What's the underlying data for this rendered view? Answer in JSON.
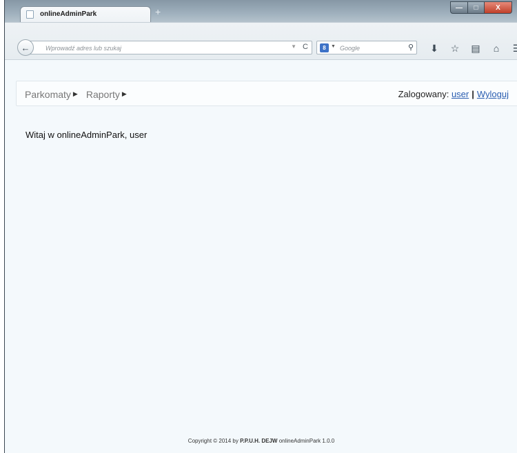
{
  "browser": {
    "tab_title": "onlineAdminPark",
    "new_tab_label": "+",
    "url_placeholder": "Wprowadź adres lub szukaj",
    "search_engine_label": "8",
    "search_placeholder": "Google",
    "icons": [
      "back-icon",
      "reload-icon",
      "search-icon",
      "download-icon",
      "bookmark-star-icon",
      "bookmarks-list-icon",
      "home-icon",
      "menu-icon"
    ]
  },
  "window_controls": {
    "minimize": "—",
    "maximize": "□",
    "close": "X"
  },
  "nav": {
    "menu": [
      {
        "label": "Parkomaty"
      },
      {
        "label": "Raporty"
      }
    ],
    "logged_in_label": "Zalogowany:",
    "user_link": "user",
    "separator": "|",
    "logout_link": "Wyloguj"
  },
  "main": {
    "welcome": "Witaj w onlineAdminPark, user"
  },
  "footer": {
    "prefix": "Copyright © 2014 by",
    "company": "P.P.U.H. DEJW",
    "suffix": "onlineAdminPark 1.0.0"
  },
  "colors": {
    "page_background": "#f4f9fc",
    "link": "#2a5db0",
    "menu_text": "#777777"
  }
}
